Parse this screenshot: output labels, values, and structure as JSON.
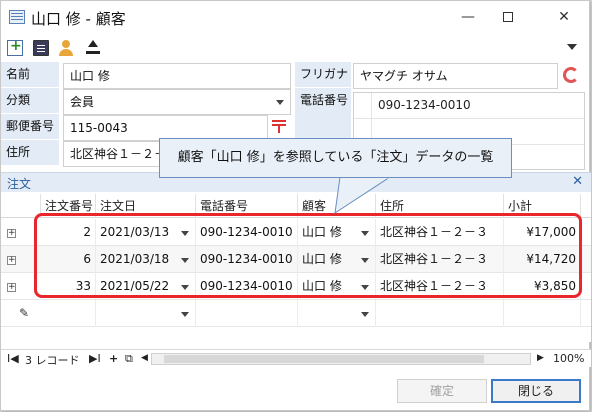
{
  "window": {
    "title": "山口 修 - 顧客",
    "minimize_symbol": "—",
    "close_symbol": "✕"
  },
  "toolbar": {
    "icons": [
      "new-record-icon",
      "document-icon",
      "user-icon",
      "upload-icon"
    ]
  },
  "form": {
    "name_label": "名前",
    "name_value": "山口 修",
    "furigana_label": "フリガナ",
    "furigana_value": "ヤマグチ オサム",
    "category_label": "分類",
    "category_value": "会員",
    "phone_label": "電話番号",
    "phone_values": [
      "090-1234-0010"
    ],
    "postal_label": "郵便番号",
    "postal_value": "115-0043",
    "address_label": "住所",
    "address_value": "北区神谷１－２－"
  },
  "callout": {
    "text": "顧客「山口 修」を参照している「注文」データの一覧"
  },
  "orders": {
    "title": "注文",
    "close_symbol": "✕",
    "columns": [
      "注文番号",
      "注文日",
      "電話番号",
      "顧客",
      "住所",
      "小計"
    ],
    "rows": [
      {
        "order_no": "2",
        "date": "2021/03/13",
        "phone": "090-1234-0010",
        "customer": "山口 修",
        "address": "北区神谷１－２－３",
        "subtotal": "¥17,000"
      },
      {
        "order_no": "6",
        "date": "2021/03/18",
        "phone": "090-1234-0010",
        "customer": "山口 修",
        "address": "北区神谷１－２－３",
        "subtotal": "¥14,720"
      },
      {
        "order_no": "33",
        "date": "2021/05/22",
        "phone": "090-1234-0010",
        "customer": "山口 修",
        "address": "北区神谷１－２－３",
        "subtotal": "¥3,850"
      }
    ],
    "expand_symbol": "+",
    "new_row_symbol": "✎"
  },
  "statusbar": {
    "first_symbol": "I◀",
    "record_count": "3 レコード",
    "last_symbol": "▶I",
    "add_symbol": "+",
    "copy_symbol": "⧉",
    "scroll_left": "◀",
    "scroll_right": "▶",
    "zoom": "100%"
  },
  "buttons": {
    "confirm": "確定",
    "close": "閉じる"
  },
  "colors": {
    "accent": "#2b5f9e",
    "label_bg": "#e3ecf6",
    "highlight": "#e8262b"
  }
}
